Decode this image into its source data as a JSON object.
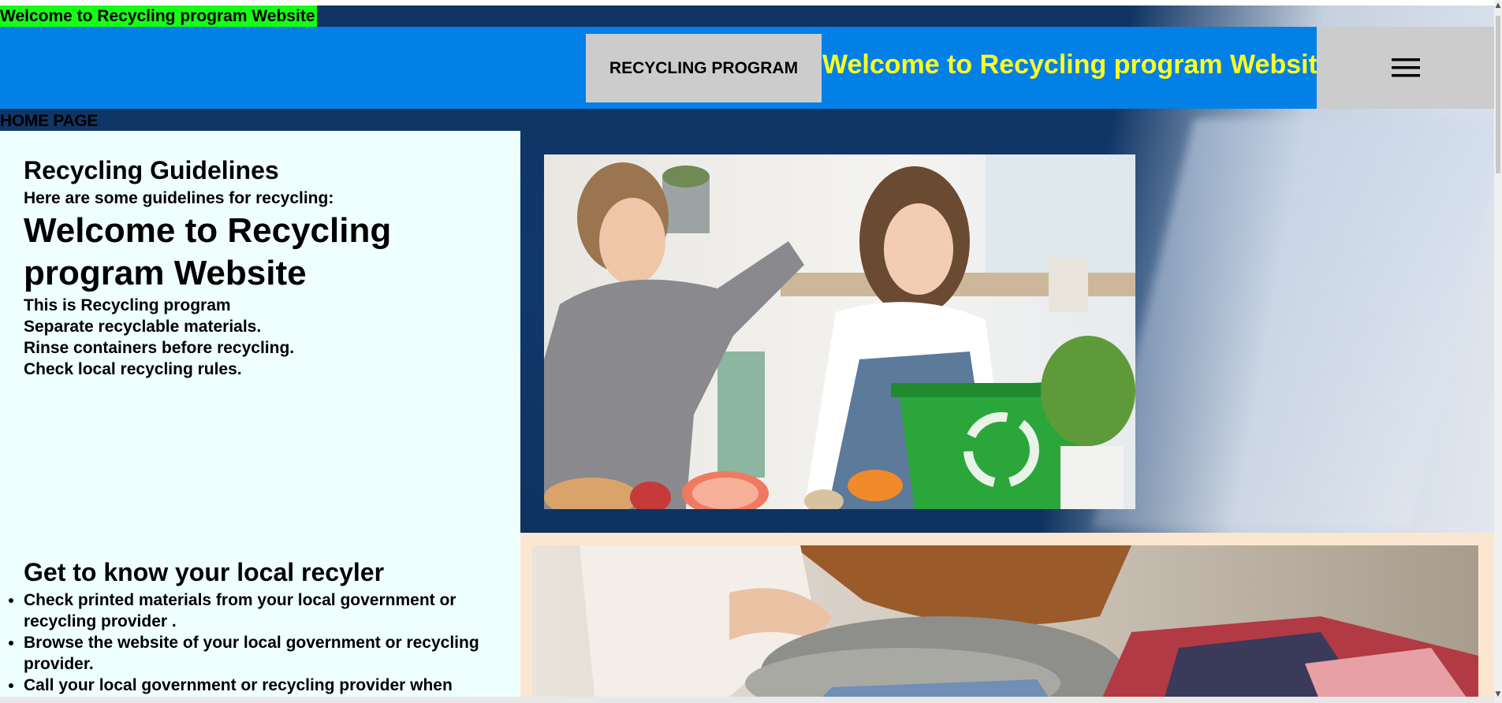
{
  "top_strip": {
    "text": "Welcome to Recycling program Website"
  },
  "header": {
    "program_button": "RECYCLING PROGRAM",
    "title": "Welcome to Recycling program Website",
    "menu_icon": "hamburger-menu-icon"
  },
  "nav": {
    "home": "HOME PAGE"
  },
  "guidelines": {
    "heading": "Recycling Guidelines",
    "intro": "Here are some guidelines for recycling:",
    "title": "Welcome to Recycling program Website",
    "lines": [
      "This is Recycling program",
      "Separate recyclable materials.",
      "Rinse containers before recycling.",
      "Check local recycling rules."
    ]
  },
  "local": {
    "heading": "Get to know your local recyler",
    "items": [
      "Check printed materials from your local government or recycling provider .",
      "Browse the website of your local government or recycling provider.",
      "Call your local government or recycling provider when"
    ]
  },
  "colors": {
    "header_bg": "#0280e5",
    "header_title": "#ffff22",
    "top_strip_bg": "#16ff16",
    "left_panel_bg": "#effffe",
    "button_bg": "#cccccc",
    "recycle_bin": "#2aa63a"
  },
  "images": {
    "photo1": "kids-recycling-food-scraps",
    "photo2": "folded-clothes-donation"
  }
}
